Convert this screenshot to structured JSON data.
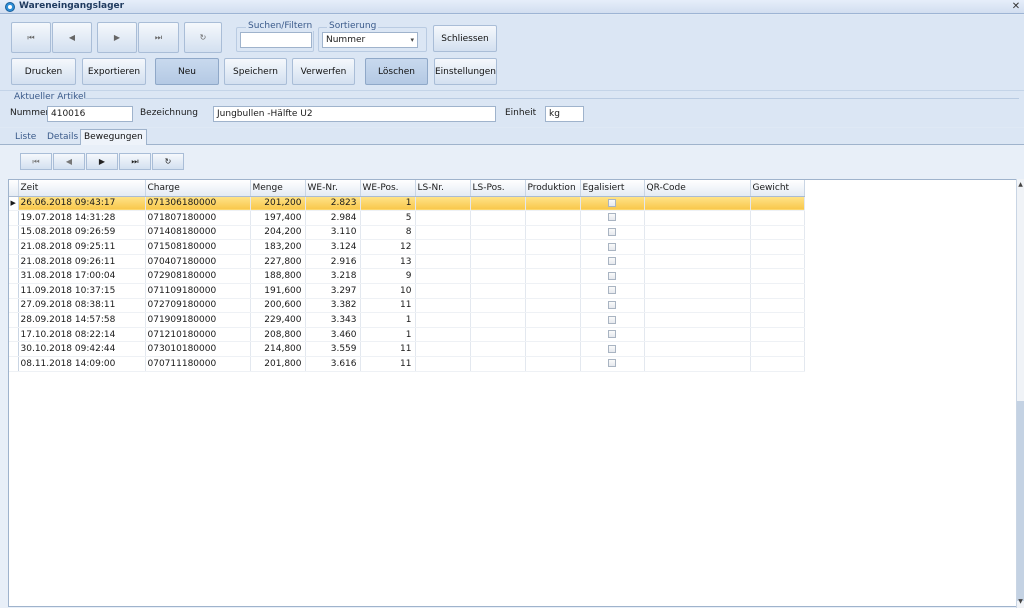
{
  "window": {
    "title": "Wareneingangslager",
    "close": "✕"
  },
  "toolbar": {
    "search_label": "Suchen/Filtern",
    "search_value": "",
    "sort_label": "Sortierung",
    "sort_value": "Nummer",
    "close_button": "Schliessen",
    "buttons": {
      "print": "Drucken",
      "export": "Exportieren",
      "new": "Neu",
      "save": "Speichern",
      "discard": "Verwerfen",
      "delete": "Löschen",
      "settings": "Einstellungen"
    }
  },
  "article": {
    "section_title": "Aktueller Artikel",
    "number_label": "Nummer",
    "number_value": "410016",
    "description_label": "Bezeichnung",
    "description_value": "Jungbullen -Hälfte U2",
    "unit_label": "Einheit",
    "unit_value": "kg"
  },
  "tabs": [
    {
      "label": "Liste"
    },
    {
      "label": "Details"
    },
    {
      "label": "Bewegungen",
      "active": true
    }
  ],
  "grid": {
    "columns": [
      "Zeit",
      "Charge",
      "Menge",
      "WE-Nr.",
      "WE-Pos.",
      "LS-Nr.",
      "LS-Pos.",
      "Produktion",
      "Egalisiert",
      "QR-Code",
      "Gewicht"
    ],
    "selected_row": 0,
    "rows": [
      {
        "zeit": "26.06.2018 09:43:17",
        "charge": "071306180000",
        "menge": "201,200",
        "we_nr": "2.823",
        "we_pos": "1"
      },
      {
        "zeit": "19.07.2018 14:31:28",
        "charge": "071807180000",
        "menge": "197,400",
        "we_nr": "2.984",
        "we_pos": "5"
      },
      {
        "zeit": "15.08.2018 09:26:59",
        "charge": "071408180000",
        "menge": "204,200",
        "we_nr": "3.110",
        "we_pos": "8"
      },
      {
        "zeit": "21.08.2018 09:25:11",
        "charge": "071508180000",
        "menge": "183,200",
        "we_nr": "3.124",
        "we_pos": "12"
      },
      {
        "zeit": "21.08.2018 09:26:11",
        "charge": "070407180000",
        "menge": "227,800",
        "we_nr": "2.916",
        "we_pos": "13"
      },
      {
        "zeit": "31.08.2018 17:00:04",
        "charge": "072908180000",
        "menge": "188,800",
        "we_nr": "3.218",
        "we_pos": "9"
      },
      {
        "zeit": "11.09.2018 10:37:15",
        "charge": "071109180000",
        "menge": "191,600",
        "we_nr": "3.297",
        "we_pos": "10"
      },
      {
        "zeit": "27.09.2018 08:38:11",
        "charge": "072709180000",
        "menge": "200,600",
        "we_nr": "3.382",
        "we_pos": "11"
      },
      {
        "zeit": "28.09.2018 14:57:58",
        "charge": "071909180000",
        "menge": "229,400",
        "we_nr": "3.343",
        "we_pos": "1"
      },
      {
        "zeit": "17.10.2018 08:22:14",
        "charge": "071210180000",
        "menge": "208,800",
        "we_nr": "3.460",
        "we_pos": "1"
      },
      {
        "zeit": "30.10.2018 09:42:44",
        "charge": "073010180000",
        "menge": "214,800",
        "we_nr": "3.559",
        "we_pos": "11"
      },
      {
        "zeit": "08.11.2018 14:09:00",
        "charge": "070711180000",
        "menge": "201,800",
        "we_nr": "3.616",
        "we_pos": "11"
      }
    ]
  },
  "icons": {
    "first": "⏮",
    "prev": "◀",
    "next": "▶",
    "last": "⏭",
    "refresh": "↻",
    "combo": "▾",
    "row_pointer": "▶"
  }
}
